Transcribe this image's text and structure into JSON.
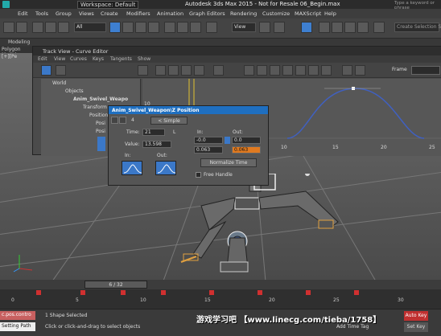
{
  "titlebar": {
    "workspace": "Workspace: Default",
    "app_title": "Autodesk 3ds Max 2015  -  Not for Resale   06_Begin.max",
    "search_placeholder": "Type a keyword or phrase"
  },
  "menu": {
    "items": [
      "Edit",
      "Tools",
      "Group",
      "Views",
      "Create",
      "Modifiers",
      "Animation",
      "Graph Editors",
      "Rendering",
      "Customize",
      "MAXScript",
      "Help"
    ]
  },
  "toolbar": {
    "selection_filter": "All",
    "view_dropdown": "View",
    "named_selection": "Create Selection Set"
  },
  "ribbon": {
    "modeling": "Modeling",
    "polygon_modeling": "Polygon Model"
  },
  "viewport": {
    "label": "[+][Pe"
  },
  "trackview": {
    "title": "Track View - Curve Editor",
    "menu": [
      "Edit",
      "View",
      "Curves",
      "Keys",
      "Tangents",
      "Show"
    ],
    "frame_label": "Frame",
    "tree": [
      "World",
      "Objects",
      "Anim_Swivel_Weapo",
      "Transform",
      "Position",
      "Posi",
      "Posi"
    ],
    "axis_ticks": [
      "10",
      "15",
      "20",
      "25"
    ],
    "value_label": "10"
  },
  "dialog": {
    "title": "Anim_Swivel_Weapon\\Z Position",
    "key_number": "4",
    "simple_btn": "< Simple",
    "time_label": "Time:",
    "time_value": "21",
    "lock_label": "L",
    "value_label": "Value:",
    "value_value": "13.598",
    "in_label": "In:",
    "out_label": "Out:",
    "in_col": "In:",
    "out_col": "Out:",
    "in_val1": "-0.0",
    "out_val1": "0.0",
    "in_val2": "0.063",
    "out_val2": "0.063",
    "normalize_btn": "Normalize Time",
    "free_handle": "Free Handle"
  },
  "timeline": {
    "frame_slider": "6 / 32"
  },
  "ruler_ticks": [
    "0",
    "5",
    "10",
    "15",
    "20",
    "25",
    "30"
  ],
  "status": {
    "script_field": "c.pos.contro",
    "shape_selected": "1 Shape Selected",
    "prompt": "Click or click-and-drag to select objects",
    "setting_path": "Setting Path",
    "add_time_tag": "Add Time Tag",
    "set_key": "Set Key",
    "auto_key": "Auto Key"
  },
  "watermark": "游戏学习吧 【www.linecg.com/tieba/1758】"
}
